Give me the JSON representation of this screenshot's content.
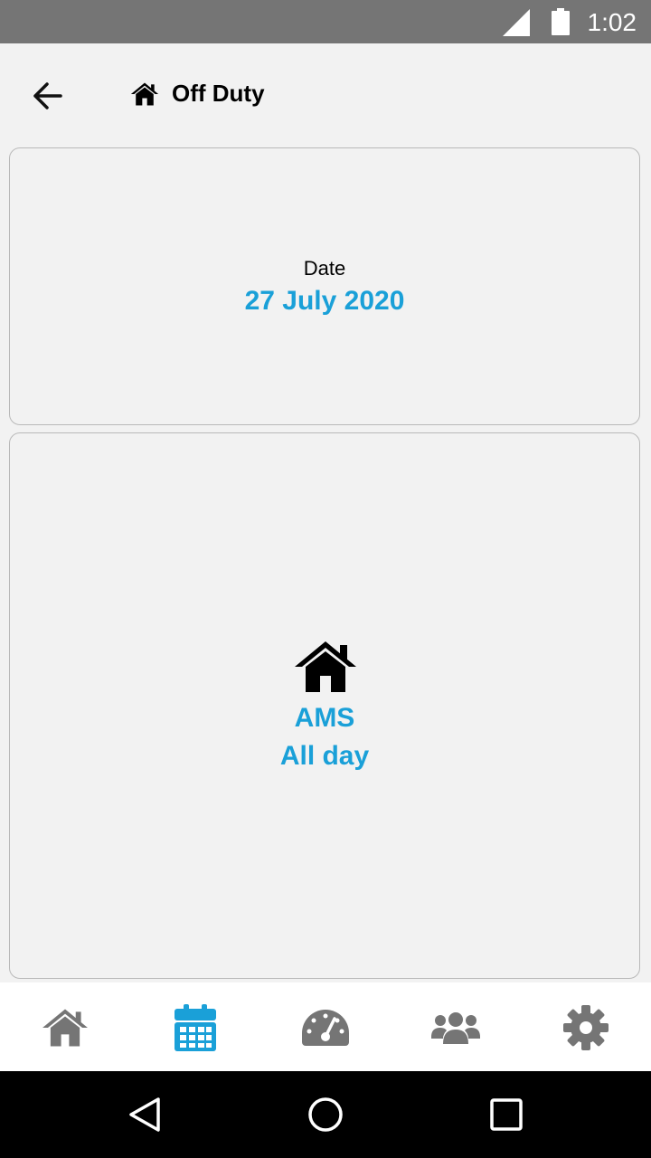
{
  "status_bar": {
    "time": "1:02",
    "icons": [
      "signal-icon",
      "battery-icon"
    ]
  },
  "app_bar": {
    "back_icon": "arrow-left-icon",
    "title_icon": "home-icon",
    "title": "Off Duty"
  },
  "date_card": {
    "label": "Date",
    "value": "27 July 2020"
  },
  "duty_card": {
    "icon": "home-icon",
    "location": "AMS",
    "time": "All day"
  },
  "bottom_nav": {
    "items": [
      {
        "icon": "home-icon",
        "active": false
      },
      {
        "icon": "calendar-icon",
        "active": true
      },
      {
        "icon": "speedometer-icon",
        "active": false
      },
      {
        "icon": "users-icon",
        "active": false
      },
      {
        "icon": "gear-icon",
        "active": false
      }
    ],
    "active_color": "#1aa0d8",
    "inactive_color": "#757575"
  },
  "system_nav": {
    "items": [
      "back-triangle-icon",
      "home-circle-icon",
      "recents-square-icon"
    ]
  },
  "colors": {
    "accent": "#1aa0d8",
    "background": "#f2f2f2",
    "status_bar": "#757575"
  }
}
